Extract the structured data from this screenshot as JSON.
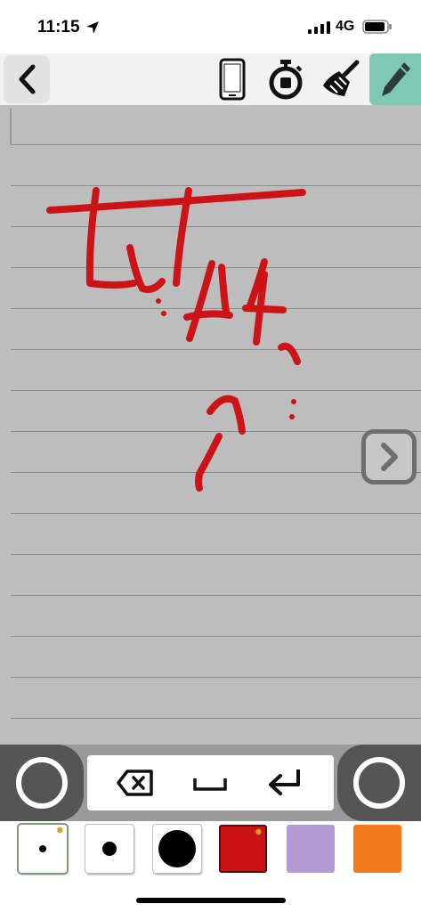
{
  "status_bar": {
    "time": "11:15",
    "network": "4G",
    "location_icon": "location-arrow-icon",
    "signal_icon": "cellular-signal-icon",
    "battery_icon": "battery-icon"
  },
  "toolbar": {
    "buttons": [
      {
        "name": "back-button",
        "icon": "chevron-left-icon"
      },
      {
        "name": "device-button",
        "icon": "phone-icon"
      },
      {
        "name": "timer-button",
        "icon": "stopwatch-icon"
      },
      {
        "name": "clear-button",
        "icon": "broom-icon"
      },
      {
        "name": "pen-button",
        "icon": "pencil-icon",
        "active": true,
        "color": "#7ec8b4"
      }
    ]
  },
  "canvas": {
    "background": "#bdbdbd",
    "ruled_line_color": "#8c8c8c",
    "ink_color": "#cc1418",
    "next_button_icon": "chevron-right-icon"
  },
  "keys": {
    "left_pad_icon": "circle-icon",
    "right_pad_icon": "circle-icon",
    "backspace_icon": "backspace-icon",
    "space_icon": "space-icon",
    "enter_icon": "return-icon"
  },
  "palette": {
    "pen_sizes": [
      "small",
      "medium",
      "large"
    ],
    "colors": [
      "#cc1418",
      "#b39bd4",
      "#f57a1c"
    ],
    "selected_color": "#cc1418",
    "settings_icon": "gear-icon"
  }
}
